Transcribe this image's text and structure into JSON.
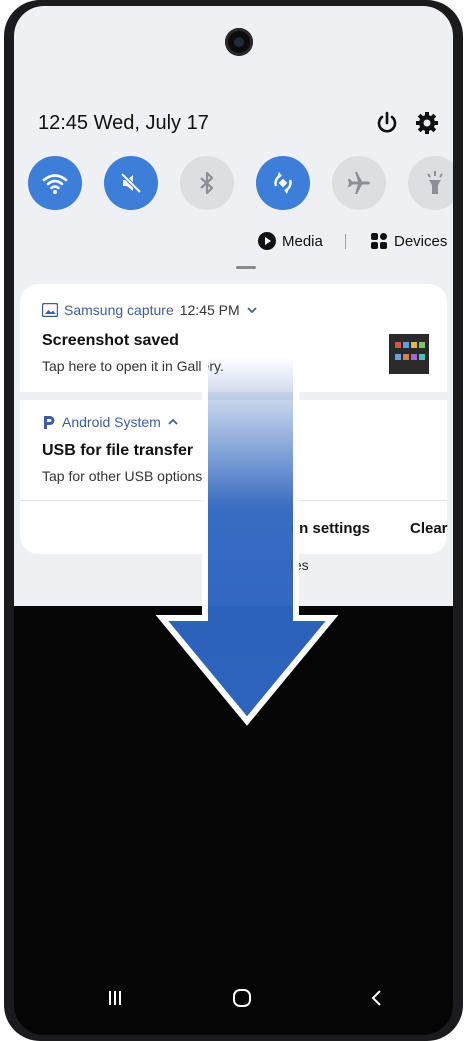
{
  "status": {
    "datetime": "12:45  Wed, July 17"
  },
  "header_icons": [
    "power-icon",
    "settings-gear-icon"
  ],
  "quick_settings": [
    {
      "name": "wifi-toggle",
      "icon": "wifi-icon",
      "state": "on"
    },
    {
      "name": "sound-toggle",
      "icon": "mute-icon",
      "state": "on"
    },
    {
      "name": "bluetooth-toggle",
      "icon": "bluetooth-icon",
      "state": "off"
    },
    {
      "name": "auto-rotate-toggle",
      "icon": "rotate-icon",
      "state": "on"
    },
    {
      "name": "airplane-toggle",
      "icon": "airplane-icon",
      "state": "off"
    },
    {
      "name": "flashlight-toggle",
      "icon": "flashlight-icon",
      "state": "off"
    }
  ],
  "media_row": {
    "media_label": "Media",
    "devices_label": "Devices"
  },
  "notifications": [
    {
      "app": "Samsung capture",
      "time": "12:45 PM",
      "title": "Screenshot saved",
      "text": "Tap here to open it in Gallery."
    },
    {
      "app": "Android System",
      "title": "USB for file transfer",
      "text": "Tap for other USB options"
    }
  ],
  "actions": {
    "settings_label": "on settings",
    "clear_label": "Clear"
  },
  "faded_text": "tes",
  "colors": {
    "accent": "#3d7fd8",
    "arrow": "#2e64bf",
    "shade": "#eef0f3"
  },
  "navbar": [
    "recents-icon",
    "home-icon",
    "back-icon"
  ]
}
